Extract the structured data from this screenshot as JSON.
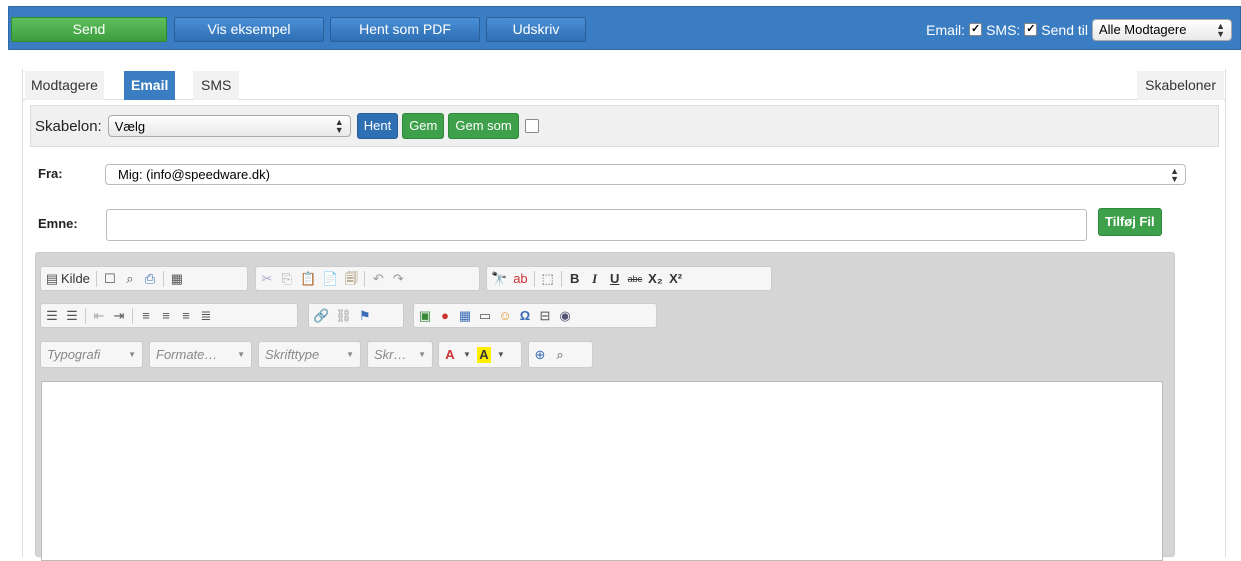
{
  "topbar": {
    "send": "Send",
    "preview": "Vis eksempel",
    "pdf": "Hent som PDF",
    "print": "Udskriv",
    "email_label": "Email:",
    "sms_label": "SMS:",
    "sendto_label": "Send til",
    "recipients_select": "Alle Modtagere",
    "email_checked": "✓",
    "sms_checked": "✓"
  },
  "tabs": {
    "recipients": "Modtagere",
    "email": "Email",
    "sms": "SMS",
    "templates": "Skabeloner"
  },
  "template": {
    "label": "Skabelon:",
    "select": "Vælg",
    "load": "Hent",
    "save": "Gem",
    "save_as": "Gem som"
  },
  "form": {
    "from_label": "Fra:",
    "from_value": "Mig: (info@speedware.dk)",
    "subject_label": "Emne:",
    "subject_value": "",
    "attach": "Tilføj Fil"
  },
  "editor": {
    "source": "Kilde",
    "combo_typografi": "Typografi",
    "combo_format": "Formate…",
    "combo_font": "Skrifttype",
    "combo_size": "Skr…",
    "bold": "B",
    "italic": "I",
    "underline": "U",
    "strike": "abc",
    "subscript": "X₂",
    "superscript": "X²"
  },
  "colors": {
    "topbar": "#3a7dc2",
    "green": "#3ea04a",
    "blue": "#2f6fb4"
  }
}
